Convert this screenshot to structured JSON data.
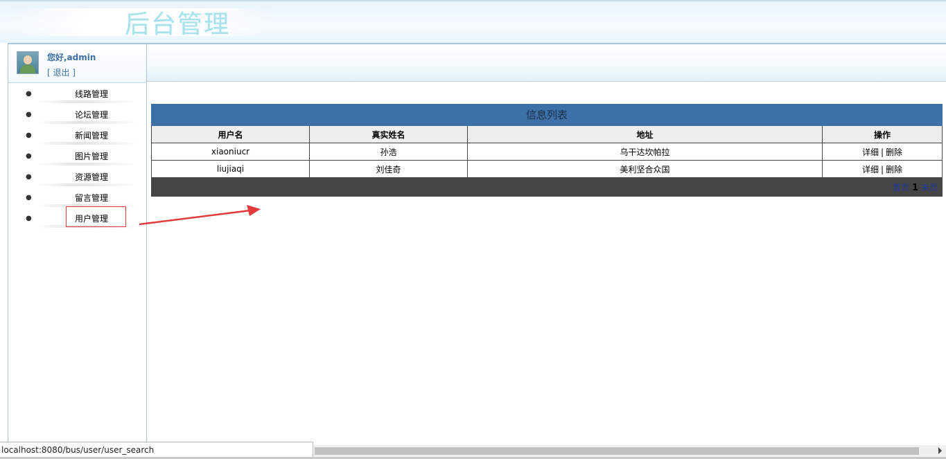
{
  "header": {
    "title": "后台管理"
  },
  "user": {
    "greeting": "您好,admin",
    "logout": "[ 退出 ]"
  },
  "sidebar": {
    "items": [
      {
        "label": "线路管理"
      },
      {
        "label": "论坛管理"
      },
      {
        "label": "新闻管理"
      },
      {
        "label": "图片管理"
      },
      {
        "label": "资源管理"
      },
      {
        "label": "留言管理"
      },
      {
        "label": "用户管理"
      }
    ]
  },
  "table": {
    "caption": "信息列表",
    "columns": [
      "用户名",
      "真实姓名",
      "地址",
      "操作"
    ],
    "rows": [
      {
        "username": "xiaoniucr",
        "realname": "孙浩",
        "address": "乌干达坎帕拉",
        "detail": "详细",
        "delete": "删除"
      },
      {
        "username": "liujiaqi",
        "realname": "刘佳奇",
        "address": "美利坚合众国",
        "detail": "详细",
        "delete": "删除"
      }
    ],
    "pager": {
      "first": "首页",
      "current": "1",
      "last": "末页"
    },
    "separator": "|"
  },
  "statusbar": {
    "url": "localhost:8080/bus/user/user_search"
  },
  "colors": {
    "caption_bg": "#3e70a8",
    "pager_bg": "#454545",
    "header_bg": "#eeeeee",
    "annotation_red": "#e23a3a",
    "link_blue": "#3d6fa4"
  }
}
